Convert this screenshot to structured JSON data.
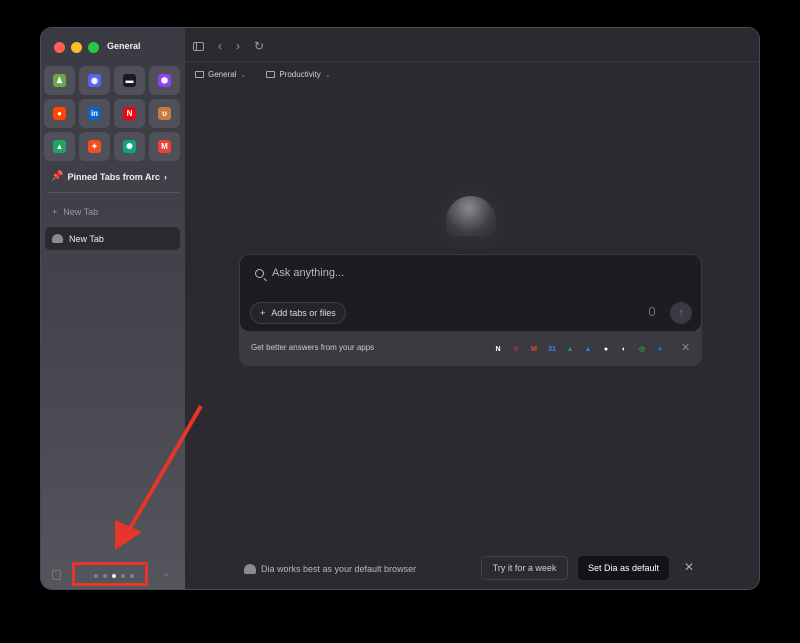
{
  "window": {
    "space_name": "General"
  },
  "sidebar": {
    "pinned_icons": [
      {
        "name": "chess-icon",
        "glyph": "♟",
        "color": "#6aa84f"
      },
      {
        "name": "discord-icon",
        "glyph": "◉",
        "color": "#5865f2"
      },
      {
        "name": "dark-app-icon",
        "glyph": "▬",
        "color": "#1b1b1f"
      },
      {
        "name": "purple-app-icon",
        "glyph": "⬢",
        "color": "#8e44ec"
      },
      {
        "name": "reddit-icon",
        "glyph": "●",
        "color": "#ff4500"
      },
      {
        "name": "linkedin-icon",
        "glyph": "in",
        "color": "#0a66c2"
      },
      {
        "name": "netflix-icon",
        "glyph": "N",
        "color": "#e50914"
      },
      {
        "name": "bear-icon",
        "glyph": "ʊ",
        "color": "#c77b3f"
      },
      {
        "name": "google-drive-icon",
        "glyph": "▲",
        "color": "#1fa463"
      },
      {
        "name": "figma-icon",
        "glyph": "✦",
        "color": "#f24e1e"
      },
      {
        "name": "chatgpt-icon",
        "glyph": "✺",
        "color": "#10a37f"
      },
      {
        "name": "gmail-icon",
        "glyph": "M",
        "color": "#ea4335"
      }
    ],
    "pinned_from_arc": "Pinned Tabs from Arc",
    "new_tab_label": "New Tab",
    "active_tab_label": "New Tab"
  },
  "bookmarks": [
    {
      "label": "General"
    },
    {
      "label": "Productivity"
    }
  ],
  "ask": {
    "placeholder": "Ask anything...",
    "add_button": "Add tabs or files",
    "apps_prompt": "Get better answers from your apps",
    "app_icons": [
      {
        "name": "notion-icon",
        "glyph": "N",
        "color": "#ffffff"
      },
      {
        "name": "slack-icon",
        "glyph": "#",
        "color": "#e01e5a"
      },
      {
        "name": "gmail-icon",
        "glyph": "M",
        "color": "#ea4335"
      },
      {
        "name": "google-calendar-icon",
        "glyph": "31",
        "color": "#4285f4"
      },
      {
        "name": "google-drive-icon",
        "glyph": "▲",
        "color": "#1fa463"
      },
      {
        "name": "atlassian-icon",
        "glyph": "▲",
        "color": "#2684ff"
      },
      {
        "name": "github-icon",
        "glyph": "●",
        "color": "#ffffff"
      },
      {
        "name": "linear-icon",
        "glyph": "◐",
        "color": "#ffffff"
      },
      {
        "name": "greenhouse-icon",
        "glyph": "◎",
        "color": "#24a148"
      },
      {
        "name": "blue-app-icon",
        "glyph": "●",
        "color": "#1f6feb"
      }
    ]
  },
  "banner": {
    "message": "Dia works best as your default browser",
    "try_button": "Try it for a week",
    "default_button": "Set Dia as default"
  },
  "colors": {
    "annotation": "#e8352a"
  }
}
